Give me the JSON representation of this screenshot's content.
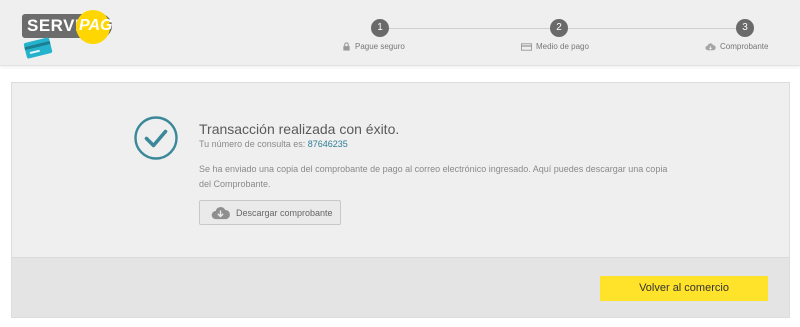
{
  "header": {
    "logo": {
      "text_servi": "SERVI",
      "text_pag": "PAG"
    },
    "steps": [
      {
        "number": "1",
        "label": "Pague seguro",
        "icon": "lock-icon"
      },
      {
        "number": "2",
        "label": "Medio de pago",
        "icon": "credit-card-icon"
      },
      {
        "number": "3",
        "label": "Comprobante",
        "icon": "cloud-download-icon"
      }
    ]
  },
  "confirmation": {
    "title": "Transacción realizada con éxito.",
    "reference_prefix": "Tu número de consulta es:",
    "reference_number": "87646235",
    "description": "Se ha enviado una copia del comprobante de pago al correo electrónico ingresado. Aquí puedes descargar una copia del Comprobante.",
    "download_label": "Descargar comprobante"
  },
  "footer": {
    "back_label": "Volver al comercio"
  },
  "colors": {
    "accent_teal": "#3a8899",
    "button_yellow": "#ffe22a",
    "logo_yellow": "#ffd600",
    "card_cyan": "#25b2cc"
  }
}
